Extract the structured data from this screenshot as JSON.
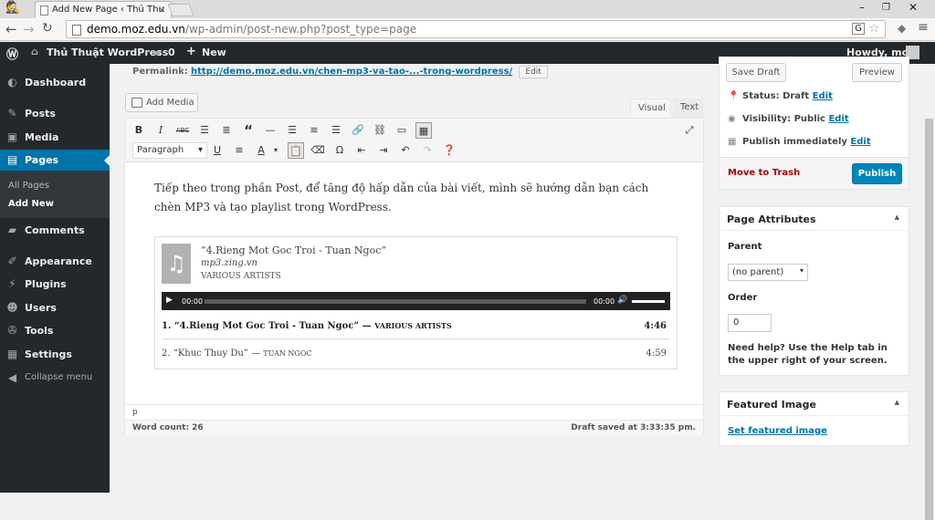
{
  "browser": {
    "tab_title": "Add New Page ‹ Thủ Thu",
    "url_host": "demo.moz.edu.vn",
    "url_path": "/wp-admin/post-new.php?post_type=page"
  },
  "adminbar": {
    "site_name": "Thủ Thuật WordPress",
    "comments": "0",
    "new": "New",
    "howdy": "Howdy, moz"
  },
  "menu": {
    "items": [
      {
        "label": "Dashboard",
        "icon": "dashboard-icon"
      },
      {
        "label": "Posts",
        "icon": "pin-icon"
      },
      {
        "label": "Media",
        "icon": "media-icon"
      },
      {
        "label": "Pages",
        "icon": "pages-icon"
      },
      {
        "label": "Comments",
        "icon": "comments-icon"
      },
      {
        "label": "Appearance",
        "icon": "brush-icon"
      },
      {
        "label": "Plugins",
        "icon": "plug-icon"
      },
      {
        "label": "Users",
        "icon": "users-icon"
      },
      {
        "label": "Tools",
        "icon": "wrench-icon"
      },
      {
        "label": "Settings",
        "icon": "settings-icon"
      }
    ],
    "sub": [
      "All Pages",
      "Add New"
    ],
    "collapse": "Collapse menu"
  },
  "permalink": {
    "label": "Permalink:",
    "url": "http://demo.moz.edu.vn/chen-mp3-va-tao-...-trong-wordpress/",
    "edit": "Edit"
  },
  "editor": {
    "add_media": "Add Media",
    "tab_visual": "Visual",
    "tab_text": "Text",
    "format": "Paragraph",
    "content": "Tiếp theo trong phần Post, để tăng độ hấp dẫn của bài viết, mình sẽ hướng dẫn bạn cách chèn MP3 và tạo playlist trong WordPress.",
    "path": "p",
    "word_count": "Word count: 26",
    "draft_saved": "Draft saved at 3:33:35 pm."
  },
  "playlist": {
    "current_title": "“4.Rieng Mot Goc Troi - Tuan Ngoc”",
    "current_album": "mp3.zing.vn",
    "current_artist": "VARIOUS ARTISTS",
    "time_start": "00:00",
    "time_end": "00:00",
    "tracks": [
      {
        "title": "1. “4.Rieng Mot Goc Troi - Tuan Ngoc”",
        "artist": "VARIOUS ARTISTS",
        "duration": "4:46"
      },
      {
        "title": "2. “Khuc Thuy Du”",
        "artist": "TUAN NGOC",
        "duration": "4:59"
      }
    ]
  },
  "publish": {
    "save_draft": "Save Draft",
    "preview": "Preview",
    "status_label": "Status: Draft",
    "visibility_label": "Visibility: Public",
    "schedule_label": "Publish immediately",
    "edit": "Edit",
    "trash": "Move to Trash",
    "publish": "Publish"
  },
  "attributes": {
    "title": "Page Attributes",
    "parent_label": "Parent",
    "parent_value": "(no parent)",
    "order_label": "Order",
    "order_value": "0",
    "help": "Need help? Use the Help tab in the upper right of your screen."
  },
  "featured": {
    "title": "Featured Image",
    "link": "Set featured image"
  }
}
